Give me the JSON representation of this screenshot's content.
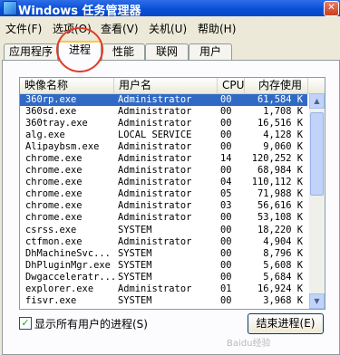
{
  "window": {
    "title": "Windows 任务管理器"
  },
  "menu": [
    "文件(F)",
    "选项(O)",
    "查看(V)",
    "关机(U)",
    "帮助(H)"
  ],
  "tabs": [
    "应用程序",
    "进程",
    "性能",
    "联网",
    "用户"
  ],
  "active_tab": "进程",
  "columns": {
    "image": "映像名称",
    "user": "用户名",
    "cpu": "CPU",
    "mem": "内存使用"
  },
  "processes": [
    {
      "name": "360rp.exe",
      "user": "Administrator",
      "cpu": "00",
      "mem": "61,584 K",
      "selected": true
    },
    {
      "name": "360sd.exe",
      "user": "Administrator",
      "cpu": "00",
      "mem": "1,708 K"
    },
    {
      "name": "360tray.exe",
      "user": "Administrator",
      "cpu": "00",
      "mem": "16,516 K"
    },
    {
      "name": "alg.exe",
      "user": "LOCAL SERVICE",
      "cpu": "00",
      "mem": "4,128 K"
    },
    {
      "name": "Alipaybsm.exe",
      "user": "Administrator",
      "cpu": "00",
      "mem": "9,060 K"
    },
    {
      "name": "chrome.exe",
      "user": "Administrator",
      "cpu": "14",
      "mem": "120,252 K"
    },
    {
      "name": "chrome.exe",
      "user": "Administrator",
      "cpu": "00",
      "mem": "68,984 K"
    },
    {
      "name": "chrome.exe",
      "user": "Administrator",
      "cpu": "04",
      "mem": "110,112 K"
    },
    {
      "name": "chrome.exe",
      "user": "Administrator",
      "cpu": "05",
      "mem": "71,988 K"
    },
    {
      "name": "chrome.exe",
      "user": "Administrator",
      "cpu": "03",
      "mem": "56,616 K"
    },
    {
      "name": "chrome.exe",
      "user": "Administrator",
      "cpu": "00",
      "mem": "53,108 K"
    },
    {
      "name": "csrss.exe",
      "user": "SYSTEM",
      "cpu": "00",
      "mem": "18,220 K"
    },
    {
      "name": "ctfmon.exe",
      "user": "Administrator",
      "cpu": "00",
      "mem": "4,904 K"
    },
    {
      "name": "DhMachineSvc...",
      "user": "SYSTEM",
      "cpu": "00",
      "mem": "8,796 K"
    },
    {
      "name": "DhPluginMgr.exe",
      "user": "SYSTEM",
      "cpu": "00",
      "mem": "5,608 K"
    },
    {
      "name": "Dwgacceleratr...",
      "user": "SYSTEM",
      "cpu": "00",
      "mem": "5,684 K"
    },
    {
      "name": "explorer.exe",
      "user": "Administrator",
      "cpu": "01",
      "mem": "16,924 K"
    },
    {
      "name": "fisvr.exe",
      "user": "SYSTEM",
      "cpu": "00",
      "mem": "3,968 K"
    }
  ],
  "show_all_users": {
    "label": "显示所有用户的进程(S)",
    "checked": true
  },
  "end_process_label": "结束进程(E)",
  "watermark": "Baidu经验"
}
